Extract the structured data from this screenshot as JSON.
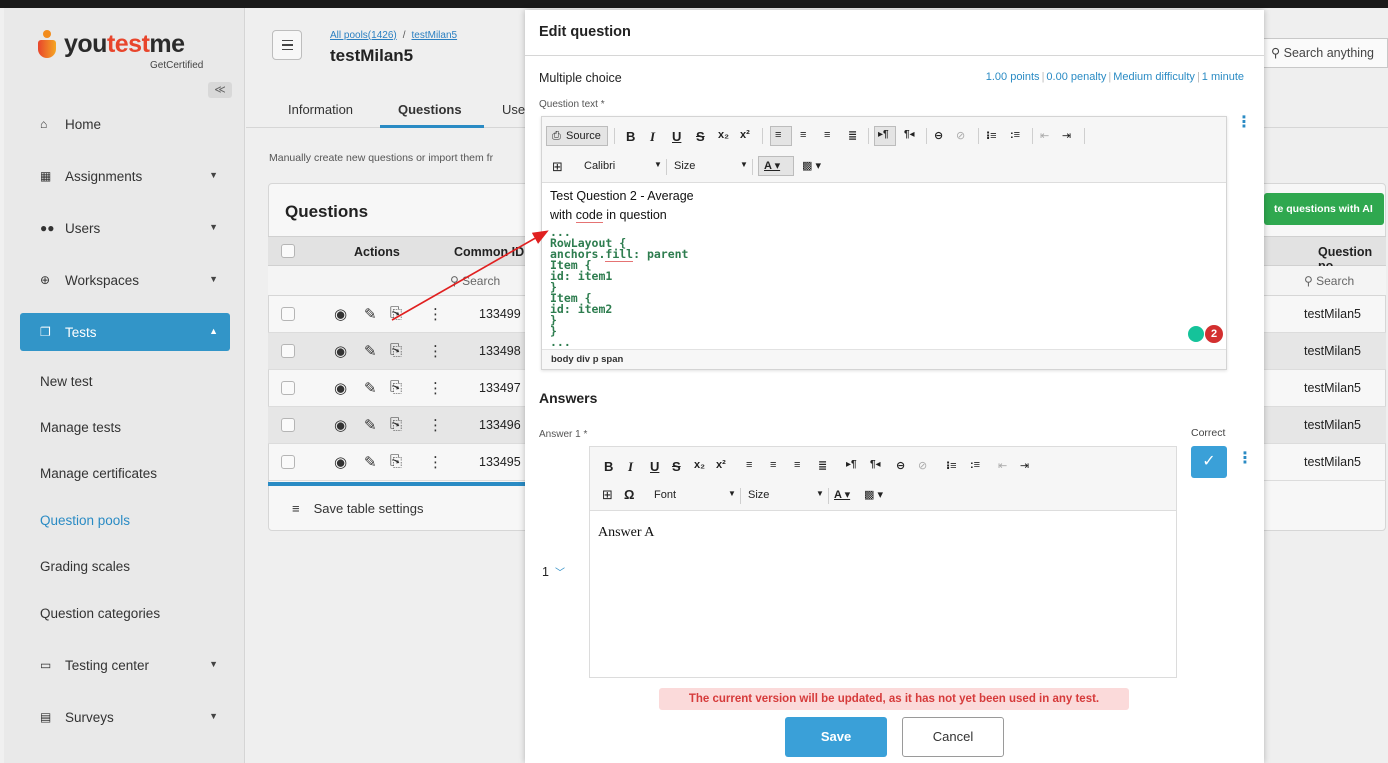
{
  "sidebar": {
    "logo_text_a": "you",
    "logo_text_b": "test",
    "logo_text_c": "me",
    "logo_sub": "GetCertified",
    "collapse": "≪",
    "items": [
      {
        "label": "Home",
        "icon": "home-icon"
      },
      {
        "label": "Assignments",
        "icon": "assignments-icon"
      },
      {
        "label": "Users",
        "icon": "users-icon"
      },
      {
        "label": "Workspaces",
        "icon": "globe-icon"
      },
      {
        "label": "Tests",
        "icon": "tests-icon"
      },
      {
        "label": "Testing center",
        "icon": "monitor-icon"
      },
      {
        "label": "Surveys",
        "icon": "surveys-icon"
      }
    ],
    "sub_items": [
      "New test",
      "Manage tests",
      "Manage certificates",
      "Question pools",
      "Grading scales",
      "Question categories"
    ]
  },
  "header": {
    "crumb_root": "All pools(1426)",
    "crumb_sep": "/",
    "crumb_leaf": "testMilan5",
    "title": "testMilan5",
    "search": "Search anything"
  },
  "tabs": [
    "Information",
    "Questions",
    "Use"
  ],
  "hint": "Manually create new questions or import them fr",
  "questions": {
    "title": "Questions",
    "ai_button": "te questions with AI",
    "col_actions": "Actions",
    "col_common_id": "Common ID",
    "col_pool": "Question po",
    "search": "Search",
    "rows": [
      {
        "id": "133499",
        "pool": "testMilan5"
      },
      {
        "id": "133498",
        "pool": "testMilan5"
      },
      {
        "id": "133497",
        "pool": "testMilan5"
      },
      {
        "id": "133496",
        "pool": "testMilan5"
      },
      {
        "id": "133495",
        "pool": "testMilan5"
      }
    ],
    "save_settings": "Save table settings"
  },
  "modal": {
    "title": "Edit question",
    "qtype": "Multiple choice",
    "meta": [
      "1.00 points",
      "0.00 penalty",
      "Medium difficulty",
      "1 minute"
    ],
    "question_label": "Question text *",
    "toolbar": {
      "source": "Source",
      "font": "Calibri",
      "size": "Size"
    },
    "question_lines": [
      "Test Question 2 - Average",
      "with ",
      "code",
      " in question"
    ],
    "code_lines": [
      "...",
      "RowLayout {",
      "anchors.",
      "fill",
      ": parent",
      "Item {",
      "id: item1",
      "}",
      "Item {",
      "id: item2",
      "}",
      "}",
      "..."
    ],
    "path": "body  div  p  span",
    "error_count": "2",
    "answers_title": "Answers",
    "answer_label": "Answer 1 *",
    "correct_label": "Correct",
    "answer_toolbar": {
      "font": "Font",
      "size": "Size"
    },
    "answer_text": "Answer A",
    "answer_order": "1",
    "warning": "The current version will be updated, as it has not yet been used in any test.",
    "save": "Save",
    "cancel": "Cancel"
  },
  "colors": {
    "accent": "#3295c8",
    "ai": "#2fa84f",
    "warning_bg": "#fbdada",
    "warning_text": "#d63b3b",
    "arrow": "#e02020"
  }
}
